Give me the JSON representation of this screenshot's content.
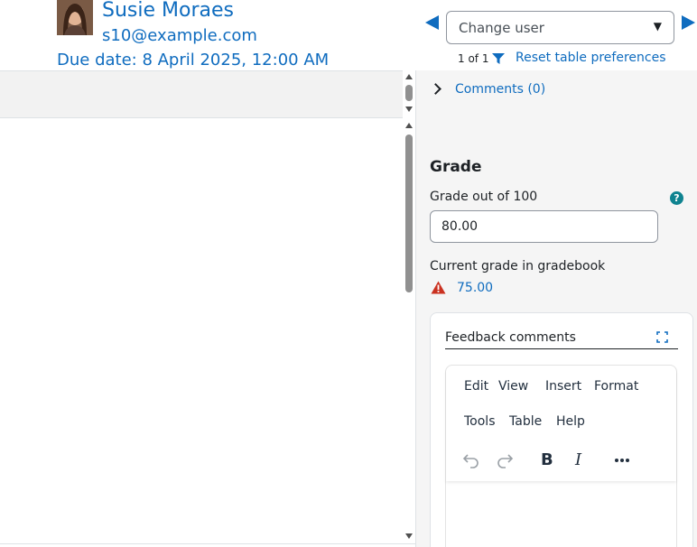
{
  "header": {
    "user_name": "Susie Moraes",
    "user_email": "s10@example.com",
    "due_date": "Due date: 8 April 2025, 12:00 AM",
    "change_user_placeholder": "Change user",
    "counter": "1 of 1",
    "reset_link": "Reset table preferences"
  },
  "panel": {
    "comments_link": "Comments (0)",
    "grade_heading": "Grade",
    "grade_label": "Grade out of 100",
    "grade_value": "80.00",
    "help_glyph": "?",
    "current_grade_label": "Current grade in gradebook",
    "current_grade_value": "75.00"
  },
  "feedback": {
    "title": "Feedback comments",
    "menu": [
      "Edit",
      "View",
      "Insert",
      "Format",
      "Tools",
      "Table",
      "Help"
    ],
    "bold_glyph": "B",
    "italic_glyph": "I"
  },
  "icons": {
    "nav_prev": "triangle-left-icon",
    "nav_next": "triangle-right-icon",
    "filter": "filter-icon",
    "warning": "warning-icon",
    "expand": "fullscreen-icon"
  },
  "colors": {
    "link": "#0f6cbf",
    "help": "#0f8390",
    "warning": "#ca3120"
  }
}
